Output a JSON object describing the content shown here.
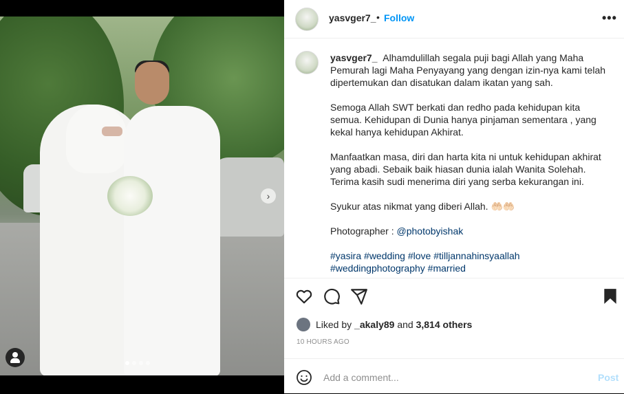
{
  "post": {
    "username": "yasvger7_",
    "separator": "•",
    "follow_label": "Follow",
    "more_icon": "more-horizontal-icon",
    "more_label": "•••"
  },
  "media": {
    "next_icon": "chevron-right-icon",
    "next_label": "›",
    "tag_icon": "user-tag-icon",
    "slide_count": 4,
    "active_slide": 1
  },
  "caption": {
    "username": "yasvger7_",
    "paragraph1": "Alhamdulillah segala puji bagi Allah yang Maha Pemurah lagi Maha Penyayang yang dengan izin-nya kami telah dipertemukan dan disatukan dalam ikatan yang sah.",
    "paragraph2": "Semoga Allah SWT berkati dan redho pada kehidupan kita semua. Kehidupan di Dunia hanya pinjaman sementara , yang kekal hanya kehidupan Akhirat.",
    "paragraph3": "Manfaatkan masa, diri dan harta kita ni untuk kehidupan akhirat yang abadi. Sebaik baik hiasan dunia ialah Wanita Solehah. Terima kasih sudi menerima diri yang serba kekurangan ini.",
    "paragraph4": "Syukur atas nikmat yang diberi Allah. 🤲🏻🤲🏻",
    "photographer_label": "Photographer : ",
    "photographer_handle": "@photobyishak",
    "hashtags": [
      "#yasira",
      "#wedding",
      "#love",
      "#tilljannahinsyaallah",
      "#weddingphotography",
      "#married"
    ]
  },
  "actions": {
    "like_icon": "heart-icon",
    "comment_icon": "comment-icon",
    "share_icon": "share-icon",
    "save_icon": "bookmark-icon"
  },
  "likes": {
    "prefix": "Liked by ",
    "first_user": "_akaly89",
    "middle": " and ",
    "others": "3,814 others"
  },
  "timestamp": "10 HOURS AGO",
  "comment": {
    "emoji_icon": "emoji-icon",
    "placeholder": "Add a comment...",
    "post_label": "Post"
  },
  "colors": {
    "accent": "#0095f6",
    "link": "#00376b",
    "post_disabled": "#b2dffc",
    "muted": "#8e8e8e"
  }
}
